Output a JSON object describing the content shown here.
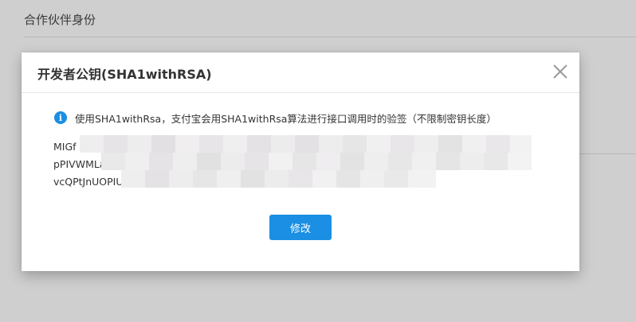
{
  "background": {
    "section_title": "合作伙伴身份"
  },
  "modal": {
    "title": "开发者公钥(SHA1withRSA)",
    "close_icon": "close-icon",
    "notice_icon": "info-icon",
    "notice_icon_glyph": "i",
    "notice_text": "使用SHA1withRsa，支付宝会用SHA1withRsa算法进行接口调用时的验签（不限制密钥长度）",
    "key_lines": [
      "MIGf",
      "pPIVWMLa",
      "vcQPtJnUOPIU"
    ],
    "edit_button_label": "修改"
  },
  "colors": {
    "primary": "#1a8fe3",
    "overlay": "#cfcfcf"
  }
}
